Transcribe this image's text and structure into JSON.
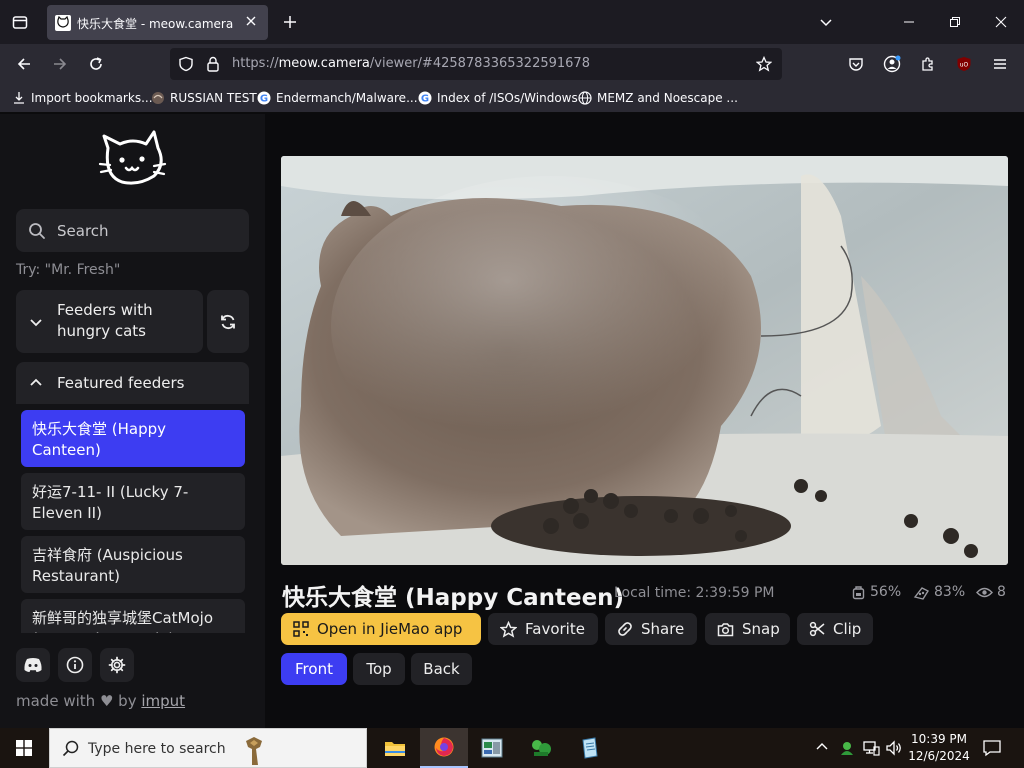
{
  "browser": {
    "tab_title": "快乐大食堂 - meow.camera",
    "url_prefix": "https://",
    "url_host": "meow.camera",
    "url_path": "/viewer/#4258783365322591678",
    "bookmarks": [
      {
        "label": "Import bookmarks...",
        "icon": "import-icon"
      },
      {
        "label": "RUSSIAN TEST",
        "icon": "site-icon"
      },
      {
        "label": "Endermanch/Malware...",
        "icon": "google-icon"
      },
      {
        "label": "Index of /ISOs/Windows",
        "icon": "google-icon"
      },
      {
        "label": "MEMZ and Noescape ...",
        "icon": "globe-icon"
      }
    ]
  },
  "sidebar": {
    "search_placeholder": "Search",
    "try_hint": "Try: \"Mr. Fresh\"",
    "hungry_panel_label": "Feeders with hungry cats",
    "featured_panel_label": "Featured feeders",
    "feeders": [
      {
        "label": "快乐大食堂 (Happy Canteen)",
        "active": true
      },
      {
        "label": "好运7-11- II  (Lucky 7-Eleven II)",
        "active": false
      },
      {
        "label": "吉祥食府 (Auspicious Restaurant)",
        "active": false
      },
      {
        "label": "新鲜哥的独享城堡CatMojo (Mr. Fresh's Castle)",
        "active": false
      }
    ],
    "footer_prefix": "made with",
    "footer_by": "by",
    "footer_link": "imput"
  },
  "viewer": {
    "title": "快乐大食堂 (Happy Canteen)",
    "local_time": "Local time: 2:39:59 PM",
    "stats": {
      "storage": "56%",
      "food": "83%",
      "viewers": "8"
    },
    "actions": {
      "open_app": "Open in JieMao app",
      "favorite": "Favorite",
      "share": "Share",
      "snap": "Snap",
      "clip": "Clip"
    },
    "views": [
      "Front",
      "Top",
      "Back"
    ],
    "active_view": "Front"
  },
  "taskbar": {
    "search_placeholder": "Type here to search",
    "time": "10:39 PM",
    "date": "12/6/2024"
  },
  "colors": {
    "accent": "#3d3df2",
    "yellow": "#f6c343"
  }
}
